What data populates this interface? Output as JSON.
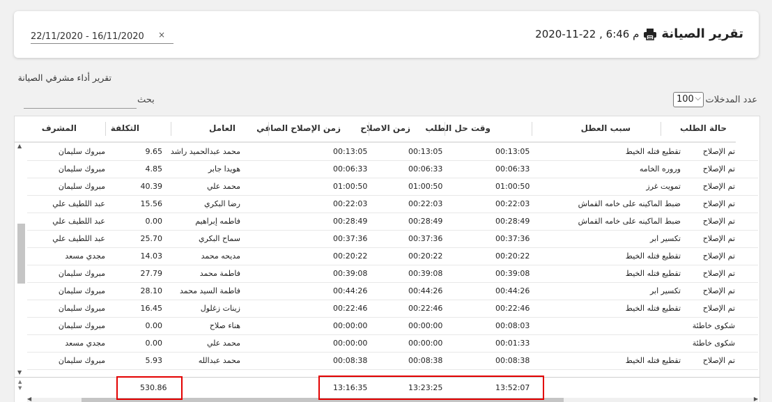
{
  "header": {
    "title": "تقرير الصيانة",
    "datetime": "2020-11-22 , 6:46 م",
    "date_range": "22/11/2020  -  16/11/2020",
    "clear_symbol": "×"
  },
  "report_subtitle": "تقرير أداء مشرفي الصيانة",
  "search": {
    "label": "بحث",
    "value": ""
  },
  "entries": {
    "label": "عدد المدخلات",
    "selected": "100"
  },
  "table": {
    "headers": {
      "status": "حالة الطلب",
      "cause": "سبب العطل",
      "resolve_time": "وقت حل الطلب",
      "repair_time": "زمن الاصلاح",
      "net_repair_time": "زمن الإصلاح الصافي",
      "worker": "العامل",
      "cost": "التكلفة",
      "supervisor": "المشرف"
    },
    "rows": [
      {
        "status": "تم الإصلاح",
        "cause": "تقطيع فتله الخيط",
        "resolve_time": "00:13:05",
        "repair_time": "00:13:05",
        "net_repair_time": "00:13:05",
        "worker": "محمد عبدالحميد راشد",
        "cost": "9.65",
        "supervisor": "مبروك سليمان"
      },
      {
        "status": "تم الإصلاح",
        "cause": "وروره الخامه",
        "resolve_time": "00:06:33",
        "repair_time": "00:06:33",
        "net_repair_time": "00:06:33",
        "worker": "هويدا جابر",
        "cost": "4.85",
        "supervisor": "مبروك سليمان"
      },
      {
        "status": "تم الإصلاح",
        "cause": "تمويت غرز",
        "resolve_time": "01:00:50",
        "repair_time": "01:00:50",
        "net_repair_time": "01:00:50",
        "worker": "محمد علي",
        "cost": "40.39",
        "supervisor": "مبروك سليمان"
      },
      {
        "status": "تم الإصلاح",
        "cause": "ضبط الماكينه على خامه القماش",
        "resolve_time": "00:22:03",
        "repair_time": "00:22:03",
        "net_repair_time": "00:22:03",
        "worker": "رضا البكري",
        "cost": "15.56",
        "supervisor": "عبد اللطيف علي"
      },
      {
        "status": "تم الإصلاح",
        "cause": "ضبط الماكينه على خامه القماش",
        "resolve_time": "00:28:49",
        "repair_time": "00:28:49",
        "net_repair_time": "00:28:49",
        "worker": "فاطمه إبراهيم",
        "cost": "0.00",
        "supervisor": "عبد اللطيف علي"
      },
      {
        "status": "تم الإصلاح",
        "cause": "تكسير ابر",
        "resolve_time": "00:37:36",
        "repair_time": "00:37:36",
        "net_repair_time": "00:37:36",
        "worker": "سماح البكري",
        "cost": "25.70",
        "supervisor": "عبد اللطيف علي"
      },
      {
        "status": "تم الإصلاح",
        "cause": "تقطيع فتله الخيط",
        "resolve_time": "00:20:22",
        "repair_time": "00:20:22",
        "net_repair_time": "00:20:22",
        "worker": "مديحه محمد",
        "cost": "14.03",
        "supervisor": "مجدي مسعد"
      },
      {
        "status": "تم الإصلاح",
        "cause": "تقطيع فتله الخيط",
        "resolve_time": "00:39:08",
        "repair_time": "00:39:08",
        "net_repair_time": "00:39:08",
        "worker": "فاطمة محمد",
        "cost": "27.79",
        "supervisor": "مبروك سليمان"
      },
      {
        "status": "تم الإصلاح",
        "cause": "تكسير ابر",
        "resolve_time": "00:44:26",
        "repair_time": "00:44:26",
        "net_repair_time": "00:44:26",
        "worker": "فاطمة السيد محمد",
        "cost": "28.10",
        "supervisor": "مبروك سليمان"
      },
      {
        "status": "تم الإصلاح",
        "cause": "تقطيع فتله الخيط",
        "resolve_time": "00:22:46",
        "repair_time": "00:22:46",
        "net_repair_time": "00:22:46",
        "worker": "زينات زغلول",
        "cost": "16.45",
        "supervisor": "مبروك سليمان"
      },
      {
        "status": "شكوى خاطئة",
        "cause": "",
        "resolve_time": "00:08:03",
        "repair_time": "00:00:00",
        "net_repair_time": "00:00:00",
        "worker": "هناء صلاح",
        "cost": "0.00",
        "supervisor": "مبروك سليمان"
      },
      {
        "status": "شكوى خاطئة",
        "cause": "",
        "resolve_time": "00:01:33",
        "repair_time": "00:00:00",
        "net_repair_time": "00:00:00",
        "worker": "محمد علي",
        "cost": "0.00",
        "supervisor": "مجدي مسعد"
      },
      {
        "status": "تم الإصلاح",
        "cause": "تقطيع فتله الخيط",
        "resolve_time": "00:08:38",
        "repair_time": "00:08:38",
        "net_repair_time": "00:08:38",
        "worker": "محمد عبدالله",
        "cost": "5.93",
        "supervisor": "مبروك سليمان"
      }
    ],
    "totals": {
      "resolve_time": "13:52:07",
      "repair_time": "13:23:25",
      "net_repair_time": "13:16:35",
      "cost": "530.86"
    }
  },
  "colors": {
    "highlight": "#e30000",
    "scroll_thumb": "#c5c5c5"
  }
}
